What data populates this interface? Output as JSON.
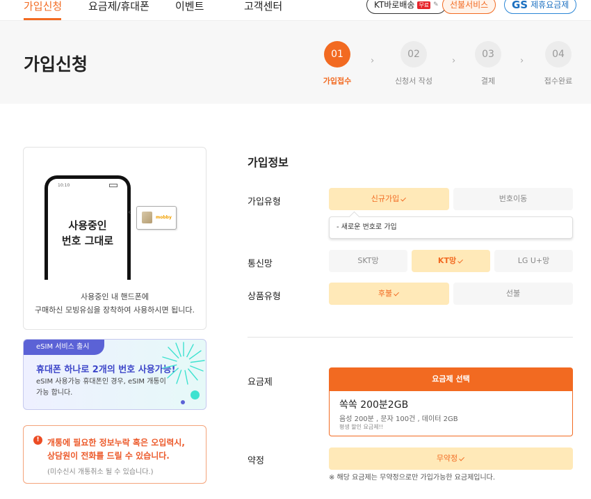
{
  "nav": {
    "items": [
      "가입신청",
      "요금제/휴대폰",
      "이벤트",
      "고객센터"
    ],
    "kt_delivery": "KT바로배송",
    "kt_delivery_tag": "무료",
    "prepaid": "선불서비스",
    "gs_logo": "GS",
    "gs_label": "제휴요금제"
  },
  "header": {
    "title": "가입신청",
    "steps": [
      {
        "num": "01",
        "label": "가입접수"
      },
      {
        "num": "02",
        "label": "신청서 작성"
      },
      {
        "num": "03",
        "label": "결제"
      },
      {
        "num": "04",
        "label": "접수완료"
      }
    ],
    "active_step": 1
  },
  "left": {
    "phone_time": "10:10",
    "phone_text_1": "사용중인",
    "phone_text_2": "번호 그대로",
    "sim_logo": "mobby",
    "desc_1": "사용중인 내 핸드폰에",
    "desc_2": "구매하신 모빙유심을 장착하여 사용하시면 됩니다.",
    "esim_tag": "eSIM 서비스 출시",
    "esim_head": "휴대폰 하나로 2개의 번호 사용가능!",
    "esim_desc_1": "eSIM 사용가능 휴대폰인 경우, eSIM 개통이",
    "esim_desc_2": "가능 합니다.",
    "warn_icon": "!",
    "warn_1": "개통에 필요한 정보누락 혹은 오입력시,",
    "warn_2": "상담원이 전화를 드릴 수 있습니다.",
    "warn_sub": "(미수신시 개통취소 될 수 있습니다.)"
  },
  "form": {
    "section_title": "가입정보",
    "join_type_label": "가입유형",
    "join_new": "신규가입",
    "join_port": "번호이동",
    "join_tooltip": "- 새로운 번호로 가입",
    "network_label": "통신망",
    "net_skt": "SKT망",
    "net_kt": "KT망",
    "net_lg": "LG U+망",
    "product_label": "상품유형",
    "prod_post": "후불",
    "prod_pre": "선불",
    "plan_label": "요금제",
    "plan_button": "요금제 선택",
    "plan_name": "쏙쏙 200분2GB",
    "plan_spec": "음성 200분 , 문자 100건 , 데이터 2GB",
    "plan_note": "평생 할인 요금제!!",
    "contract_label": "약정",
    "contract_value": "무약정",
    "contract_note": "※ 해당 요금제는 무약정으로만 가입가능한 요금제입니다."
  },
  "colors": {
    "accent": "#f26a21",
    "selected_bg": "#ffe9b8",
    "esim": "#5b62d6"
  }
}
